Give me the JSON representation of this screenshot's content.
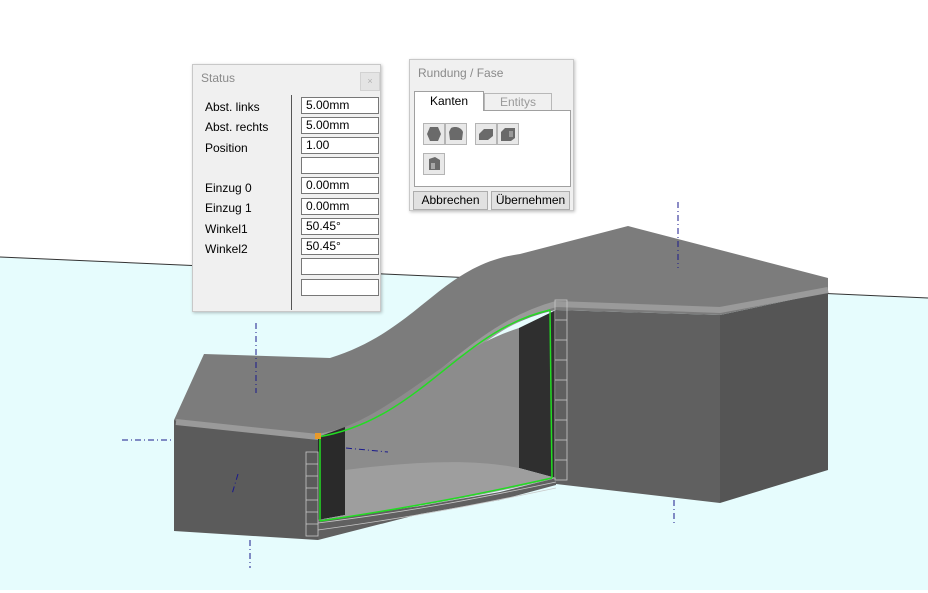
{
  "status_panel": {
    "title": "Status",
    "close_glyph": "×",
    "fields": [
      {
        "label": "Abst. links",
        "value": "5.00mm"
      },
      {
        "label": "Abst. rechts",
        "value": "5.00mm"
      },
      {
        "label": "Position",
        "value": "1.00"
      },
      {
        "label": "",
        "value": ""
      },
      {
        "label": "Einzug 0",
        "value": "0.00mm"
      },
      {
        "label": "Einzug 1",
        "value": "0.00mm"
      },
      {
        "label": "Winkel1",
        "value": "50.45°"
      },
      {
        "label": "Winkel2",
        "value": "50.45°"
      },
      {
        "label": "",
        "value": ""
      },
      {
        "label": "",
        "value": ""
      }
    ]
  },
  "fillet_panel": {
    "title": "Rundung / Fase",
    "tabs": [
      {
        "label": "Kanten",
        "active": true
      },
      {
        "label": "Entitys",
        "active": false
      }
    ],
    "tools": [
      "fillet-edge-icon",
      "fillet-face-icon",
      "chamfer-edge-icon",
      "chamfer-face-icon",
      "fillet-solid-icon"
    ],
    "cancel_label": "Abbrechen",
    "apply_label": "Übernehmen"
  },
  "colors": {
    "floor": "#e6fcfd",
    "solid_top": "#7a7a7a",
    "solid_side": "#5a5a5a",
    "selected_edge": "#22dd22",
    "axis": "#1a1a8c"
  }
}
